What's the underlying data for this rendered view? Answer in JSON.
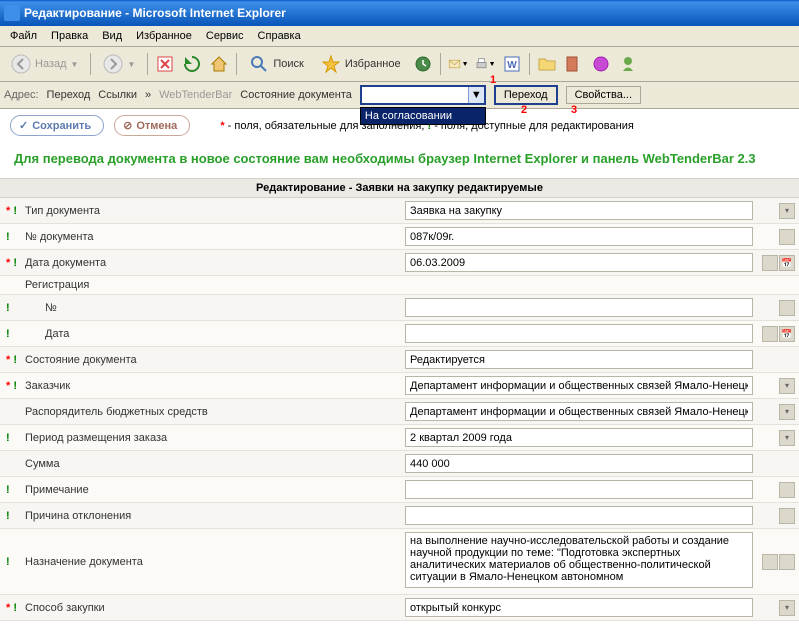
{
  "window": {
    "title": "Редактирование - Microsoft Internet Explorer"
  },
  "menu": {
    "file": "Файл",
    "edit": "Правка",
    "view": "Вид",
    "favorites": "Избранное",
    "tools": "Сервис",
    "help": "Справка"
  },
  "toolbar": {
    "back": "Назад",
    "search": "Поиск",
    "favorites": "Избранное"
  },
  "address": {
    "label": "Адрес:",
    "goto": "Переход",
    "links": "Ссылки",
    "more": "»",
    "webtender": "WebTenderBar",
    "state_label": "Состояние документа",
    "dropdown_option": "На согласовании",
    "go": "Переход",
    "properties": "Свойства..."
  },
  "annotations": {
    "a1": "1",
    "a2": "2",
    "a3": "3"
  },
  "actions": {
    "save": "Сохранить",
    "cancel": "Отмена"
  },
  "legend": {
    "star": "*",
    "req_text": " - поля, обязательные для заполнения;  ",
    "excl": "!",
    "edit_text": " - поля, доступные для редактирования"
  },
  "banner": "Для перевода документа в новое состояние вам необходимы браузер Internet Explorer и панель WebTenderBar 2.3",
  "section_header": "Редактирование - Заявки на закупку редактируемые",
  "fields": {
    "doc_type": {
      "label": "Тип документа",
      "value": "Заявка на закупку"
    },
    "doc_no": {
      "label": "№ документа",
      "value": "087к/09г."
    },
    "doc_date": {
      "label": "Дата документа",
      "value": "06.03.2009"
    },
    "registration": {
      "label": "Регистрация"
    },
    "reg_no": {
      "label": "№",
      "value": ""
    },
    "reg_date": {
      "label": "Дата",
      "value": ""
    },
    "doc_state": {
      "label": "Состояние документа",
      "value": "Редактируется"
    },
    "customer": {
      "label": "Заказчик",
      "value": "Департамент информации и общественных связей Ямало-Ненецкого авт"
    },
    "budget_mgr": {
      "label": "Распорядитель бюджетных средств",
      "value": "Департамент информации и общественных связей Ямало-Ненецкого авт"
    },
    "period": {
      "label": "Период размещения заказа",
      "value": "2 квартал 2009 года"
    },
    "sum": {
      "label": "Сумма",
      "value": "440 000"
    },
    "note": {
      "label": "Примечание",
      "value": ""
    },
    "reject_reason": {
      "label": "Причина отклонения",
      "value": ""
    },
    "purpose": {
      "label": "Назначение документа",
      "value": "на выполнение научно-исследовательской работы и создание научной продукции по теме: \"Подготовка экспертных аналитических материалов об общественно-политической ситуации в Ямало-Ненецком автономном"
    },
    "purchase_method": {
      "label": "Способ закупки",
      "value": "открытый конкурс"
    }
  }
}
